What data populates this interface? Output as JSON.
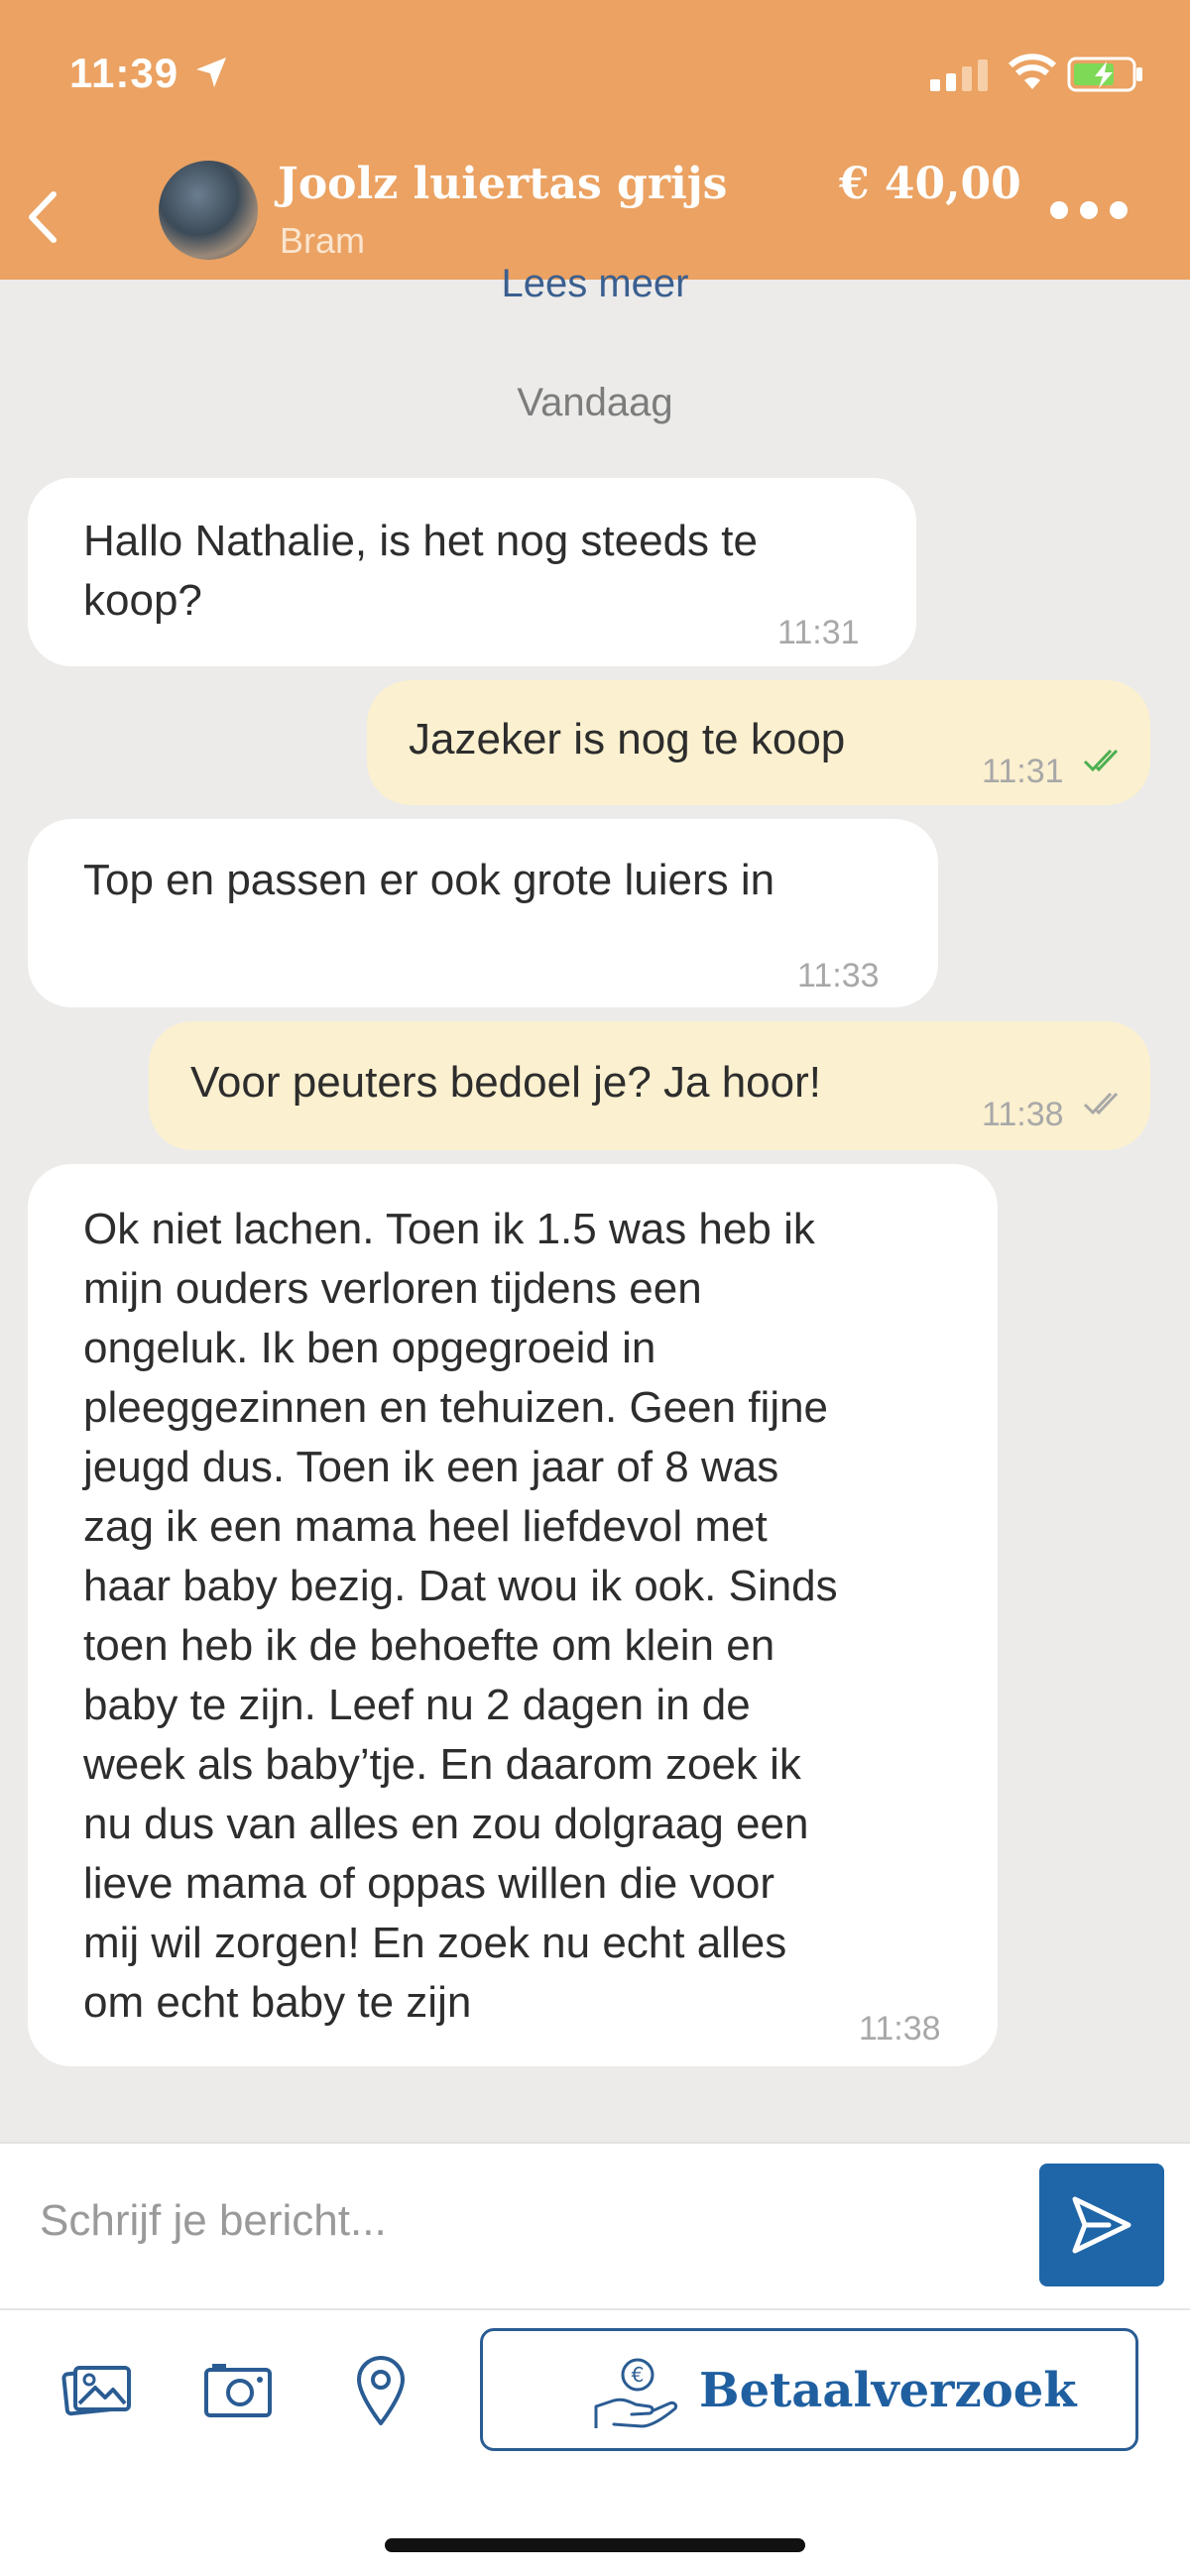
{
  "status_bar": {
    "time": "11:39"
  },
  "header": {
    "item_title": "Joolz luiertas grijs",
    "seller": "Bram",
    "price": "€ 40,00"
  },
  "chat": {
    "read_more": "Lees meer",
    "date_separator": "Vandaag",
    "messages": [
      {
        "direction": "incoming",
        "text": "Hallo Nathalie, is het nog steeds te\nkoop?",
        "time": "11:31"
      },
      {
        "direction": "outgoing",
        "text": "Jazeker is nog te koop",
        "time": "11:31",
        "status": "read"
      },
      {
        "direction": "incoming",
        "text": "Top en passen er ook grote luiers in",
        "time": "11:33"
      },
      {
        "direction": "outgoing",
        "text": "Voor peuters bedoel je? Ja hoor!",
        "time": "11:38",
        "status": "delivered"
      },
      {
        "direction": "incoming",
        "text": "Ok niet lachen. Toen ik 1.5 was heb ik\nmijn ouders verloren tijdens een\nongeluk. Ik ben opgegroeid in\npleeggezinnen en tehuizen. Geen fijne\njeugd dus. Toen ik een jaar of 8 was\nzag ik een mama heel liefdevol met\nhaar baby bezig. Dat wou ik ook. Sinds\ntoen heb ik de behoefte om klein en\nbaby te zijn. Leef nu 2 dagen in de\nweek als baby’tje.  En daarom zoek ik\nnu dus van alles en zou dolgraag een\nlieve mama of oppas willen die voor\nmij wil zorgen! En zoek nu echt alles\nom echt baby te zijn",
        "time": "11:38"
      }
    ]
  },
  "composer": {
    "placeholder": "Schrijf je bericht...",
    "pay_request_label": "Betaalverzoek"
  },
  "colors": {
    "header": "#eba262",
    "incoming_bubble": "#ffffff",
    "outgoing_bubble": "#fbf0cf",
    "accent": "#1f66a8",
    "read_tick": "#4caf50"
  },
  "icons": [
    "location-arrow-icon",
    "signal-icon",
    "wifi-icon",
    "battery-charging-icon",
    "back-chevron-icon",
    "more-dots-icon",
    "double-check-icon",
    "send-icon",
    "gallery-icon",
    "camera-icon",
    "location-pin-icon",
    "euro-hand-icon"
  ]
}
